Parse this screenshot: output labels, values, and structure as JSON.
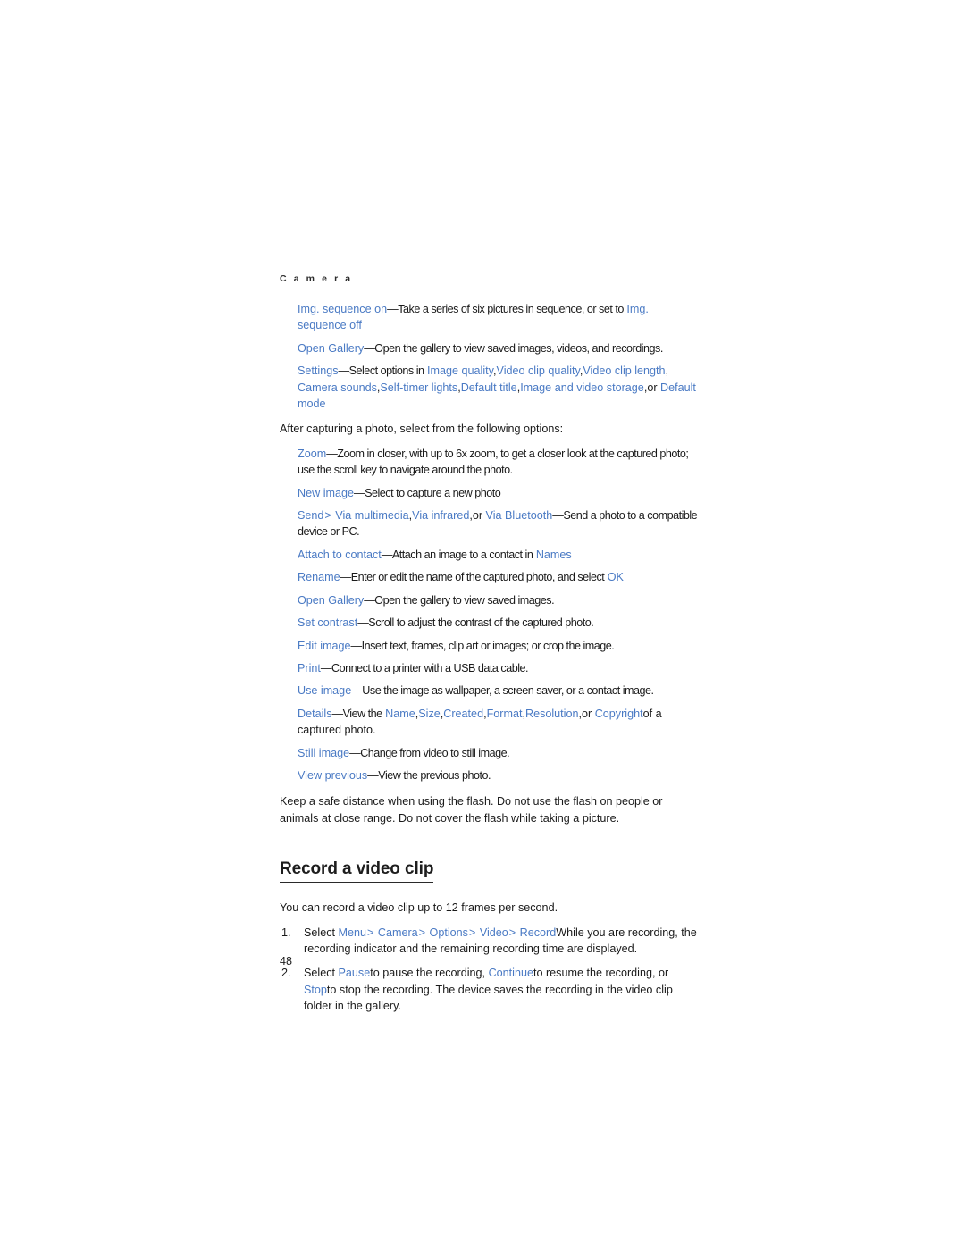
{
  "page": {
    "running_head": "C a m e r a",
    "folio": "48",
    "link_color": "#4a7ac4",
    "text_color": "#1a1a1a",
    "background": "#ffffff"
  },
  "camera_options": [
    {
      "term": "Img. sequence on",
      "term_parts": [
        "Img. sequence on"
      ],
      "text": "—Take a series of six pictures in sequence, or set to",
      "trailing_term": "Img. sequence off"
    },
    {
      "term": "Open Gallery",
      "text": "—Open the gallery to view saved images, videos, and recordings."
    },
    {
      "term": "Settings",
      "text": "—Select options in",
      "inline_terms": [
        "Image quality",
        "Video clip quality",
        "Video clip length",
        "Camera sounds",
        "Self-timer lights",
        "Default title",
        "Image and video storage",
        "Default mode"
      ],
      "conjunction": "or"
    }
  ],
  "after_capture": {
    "lede": "After capturing a photo, select from the following options:",
    "items": [
      {
        "term": "Zoom",
        "text": "—Zoom in closer, with up to 6x zoom, to get a closer look at the captured photo; use the scroll key to navigate around the photo."
      },
      {
        "term": "New image",
        "text": "—Select to capture a new photo"
      },
      {
        "term": "Send",
        "arrow": ">",
        "terms": [
          "Via multimedia",
          "Via infrared",
          "Via Bluetooth"
        ],
        "conjunction": "or",
        "text": "—Send a photo to a compatible device or PC."
      },
      {
        "term": "Attach to contact",
        "text": "—Attach an image to a contact in",
        "trailing_term": "Names"
      },
      {
        "term": "Rename",
        "text": "—Enter or edit the name of the captured photo, and select",
        "trailing_term": "OK"
      },
      {
        "term": "Open Gallery",
        "text": "—Open the gallery to view saved images."
      },
      {
        "term": "Set contrast",
        "text": "—Scroll to adjust the contrast of the captured photo."
      },
      {
        "term": "Edit image",
        "text": "—Insert text, frames, clip art or images; or crop the image."
      },
      {
        "term": "Print",
        "text": "—Connect to a printer with a USB data cable."
      },
      {
        "term": "Use image",
        "text": "—Use the image as wallpaper, a screen saver, or a contact image."
      },
      {
        "term": "Details",
        "text": "—View the",
        "terms": [
          "Name",
          "Size",
          "Created",
          "Format",
          "Resolution",
          "Copyright"
        ],
        "conjunction": "or",
        "text_end": "of a captured photo."
      },
      {
        "term": "Still image",
        "text": "—Change from video to still image."
      },
      {
        "term": "View previous",
        "text": "—View the previous photo."
      }
    ]
  },
  "flash_note": "Keep a safe distance when using the flash. Do not use the flash on people or animals at close range. Do not cover the flash while taking a picture.",
  "record_section": {
    "heading": "Record a video clip",
    "intro": "You can record a video clip up to 12 frames per second.",
    "steps": [
      {
        "number": "1.",
        "lead": "Select",
        "path": [
          "Menu",
          "Camera",
          "Options",
          "Video",
          "Record"
        ],
        "arrow": ">",
        "text": "While you are recording, the recording indicator and the remaining recording time are displayed."
      },
      {
        "number": "2.",
        "lead": "Select",
        "term_pause": "Pause",
        "text_1": "to pause the recording,",
        "term_continue": "Continue",
        "text_2": "to resume the recording, or",
        "term_stop": "Stop",
        "text_3": "to stop the recording. The device saves the recording in the video clip folder in the gallery."
      }
    ]
  }
}
